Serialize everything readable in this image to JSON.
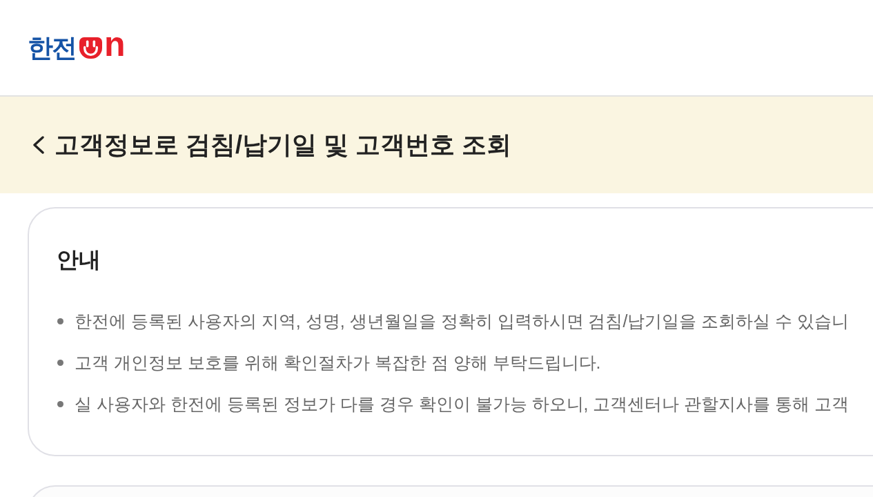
{
  "header": {
    "logo": {
      "text": "한전",
      "suffix": "n"
    }
  },
  "title_bar": {
    "title": "고객정보로 검침/납기일 및 고객번호 조회"
  },
  "notice": {
    "heading": "안내",
    "items": [
      "한전에 등록된 사용자의 지역, 성명, 생년월일을 정확히 입력하시면 검침/납기일을 조회하실 수 있습니",
      "고객 개인정보 보호를 위해 확인절차가 복잡한 점 양해 부탁드립니다.",
      "실 사용자와 한전에 등록된 정보가 다를 경우 확인이 불가능 하오니, 고객센터나 관할지사를 통해 고객"
    ]
  }
}
